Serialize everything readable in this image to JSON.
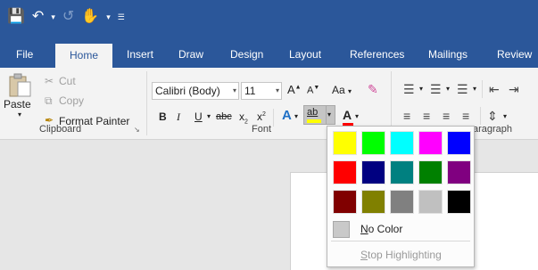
{
  "qat": {
    "save_icon": "save-icon",
    "undo_icon": "undo-icon",
    "redo_icon": "redo-icon",
    "touch_icon": "touch-mode-icon",
    "customize_icon": "customize-qat-icon"
  },
  "tabs": [
    {
      "label": "File"
    },
    {
      "label": "Home"
    },
    {
      "label": "Insert"
    },
    {
      "label": "Draw"
    },
    {
      "label": "Design"
    },
    {
      "label": "Layout"
    },
    {
      "label": "References"
    },
    {
      "label": "Mailings"
    },
    {
      "label": "Review"
    }
  ],
  "clipboard": {
    "paste": "Paste",
    "cut": "Cut",
    "copy": "Copy",
    "format_painter": "Format Painter",
    "group_label": "Clipboard"
  },
  "font": {
    "font_name": "Calibri (Body)",
    "font_size": "11",
    "grow": "A",
    "shrink": "A",
    "change_case": "Aa",
    "bold": "B",
    "italic": "I",
    "underline": "U",
    "strikethrough": "abc",
    "subscript": "x",
    "superscript": "x",
    "text_effects": "A",
    "highlight": "ab",
    "font_color": "A",
    "group_label": "Font"
  },
  "paragraph": {
    "group_label": "aragraph"
  },
  "highlight_menu": {
    "colors": [
      [
        "#ffff00",
        "#00ff00",
        "#00ffff",
        "#ff00ff",
        "#0000ff"
      ],
      [
        "#ff0000",
        "#000080",
        "#008080",
        "#008000",
        "#800080"
      ],
      [
        "#800000",
        "#808000",
        "#808080",
        "#c0c0c0",
        "#000000"
      ]
    ],
    "no_color_key": "N",
    "no_color_rest": "o Color",
    "stop_key": "S",
    "stop_rest": "top Highlighting"
  }
}
